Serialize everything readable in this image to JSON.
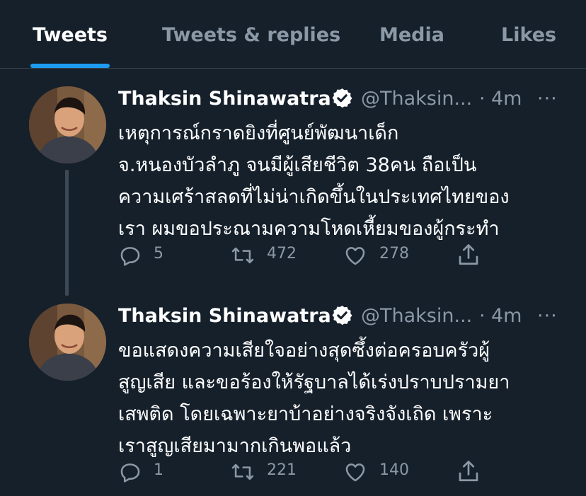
{
  "tabs": [
    {
      "label": "Tweets",
      "active": true
    },
    {
      "label": "Tweets & replies",
      "active": false
    },
    {
      "label": "Media",
      "active": false
    },
    {
      "label": "Likes",
      "active": false
    }
  ],
  "accent_color": "#1d9bf0",
  "tweets": [
    {
      "name": "Thaksin Shinawatra",
      "handle": "@Thaksin...",
      "separator": "·",
      "time": "4m",
      "more": "···",
      "text": "เหตุการณ์กราดยิงที่ศูนย์พัฒนาเด็ก\nจ.หนองบัวลำภู จนมีผู้เสียชีวิต 38คน ถือเป็น\nความเศร้าสลดที่ไม่น่าเกิดขึ้นในประเทศไทยของ\nเรา ผมขอประณามความโหดเหี้ยมของผู้กระทำ",
      "replies": "5",
      "retweets": "472",
      "likes": "278"
    },
    {
      "name": "Thaksin Shinawatra",
      "handle": "@Thaksin...",
      "separator": "·",
      "time": "4m",
      "more": "···",
      "text": "ขอแสดงความเสียใจอย่างสุดซึ้งต่อครอบครัวผู้\nสูญเสีย และขอร้องให้รัฐบาลได้เร่งปราบปรามยา\nเสพติด โดยเฉพาะยาบ้าอย่างจริงจังเถิด เพราะ\nเราสูญเสียมามากเกินพอแล้ว",
      "replies": "1",
      "retweets": "221",
      "likes": "140"
    }
  ]
}
